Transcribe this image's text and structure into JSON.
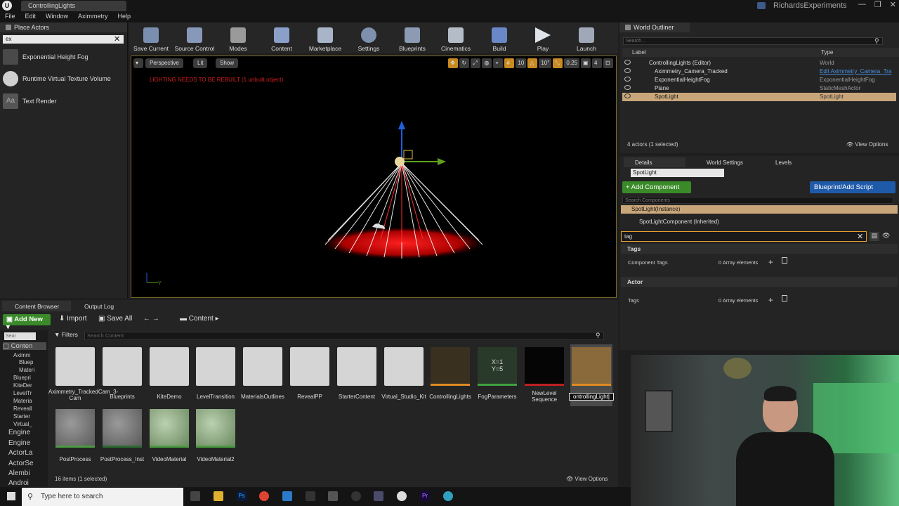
{
  "window": {
    "tab_title": "ControllingLights",
    "project": "RichardsExperiments",
    "controls": [
      "—",
      "❐",
      "✕"
    ]
  },
  "menu": [
    "File",
    "Edit",
    "Window",
    "Aximmetry",
    "Help"
  ],
  "place_actors": {
    "title": "Place Actors",
    "search_value": "ex",
    "items": [
      "Exponential Height Fog",
      "Runtime Virtual Texture Volume",
      "Text Render"
    ]
  },
  "toolbar": [
    "Save Current",
    "Source Control",
    "Modes",
    "Content",
    "Marketplace",
    "Settings",
    "Blueprints",
    "Cinematics",
    "Build",
    "Play",
    "Launch"
  ],
  "viewport": {
    "perspective": "Perspective",
    "lit": "Lit",
    "show": "Show",
    "warning": "LIGHTING NEEDS TO BE REBUILT (1 unbuilt object)",
    "grid": "10",
    "angle": "10°",
    "scale": "0.25",
    "cam": "4"
  },
  "outliner": {
    "title": "World Outliner",
    "search_placeholder": "Search...",
    "col_label": "Label",
    "col_type": "Type",
    "rows": [
      {
        "label": "ControllingLights (Editor)",
        "type": "World"
      },
      {
        "label": "Aximmetry_Camera_Tracked",
        "type": "Edit Aximmetry_Camera_Tra"
      },
      {
        "label": "ExponentialHeightFog",
        "type": "ExponentialHeightFog"
      },
      {
        "label": "Plane",
        "type": "StaticMeshActor"
      },
      {
        "label": "SpotLight",
        "type": "SpotLight"
      }
    ],
    "count": "4 actors (1 selected)",
    "view_options": "View Options"
  },
  "details": {
    "tabs": [
      "Details",
      "World Settings",
      "Levels"
    ],
    "name": "SpotLight",
    "add_component": "+ Add Component",
    "blueprint_script": "Blueprint/Add Script",
    "comp_search_placeholder": "Search Components",
    "instance": "SpotLight(Instance)",
    "component": "SpotLightComponent (Inherited)",
    "filter": "tag",
    "categories": [
      {
        "name": "Tags",
        "prop": "Component Tags",
        "value": "0 Array elements"
      },
      {
        "name": "Actor",
        "prop": "Tags",
        "value": "0 Array elements"
      }
    ]
  },
  "content_browser": {
    "tabs": [
      "Content Browser",
      "Output Log"
    ],
    "add_new": "Add New",
    "import": "Import",
    "save_all": "Save All",
    "path": "Content",
    "filters": "Filters",
    "search_placeholder": "Search Content",
    "tree_search": "Sear",
    "tree": [
      "Conten",
      "Aximm",
      "Bluep",
      "Materi",
      "Bluepri",
      "KiteDer",
      "LevelTr",
      "Materia",
      "Reveall",
      "Starter",
      "Virtual_",
      "Engine",
      "Engine",
      "ActorLa",
      "ActorSe",
      "Alembi",
      "Androi"
    ],
    "assets_row1": [
      "Aximmetry_TrackedCam_3-Cam",
      "Blueprints",
      "KiteDemo",
      "LevelTransition",
      "MaterialsOutlines",
      "RevealPP",
      "StarterContent",
      "Virtual_Studio_Kit",
      "ControllingLights",
      "FogParameters",
      "NewLevel Sequence",
      "ontrollingLight|"
    ],
    "fog_thumb": "X=1\nY=5",
    "assets_row2": [
      "PostProcess",
      "PostProcess_Inst",
      "VideoMaterial",
      "VideoMaterial2"
    ],
    "count": "16 items (1 selected)",
    "view_options": "View Options"
  },
  "taskbar": {
    "search_placeholder": "Type here to search",
    "ps": "Ps",
    "pr": "Pr"
  }
}
